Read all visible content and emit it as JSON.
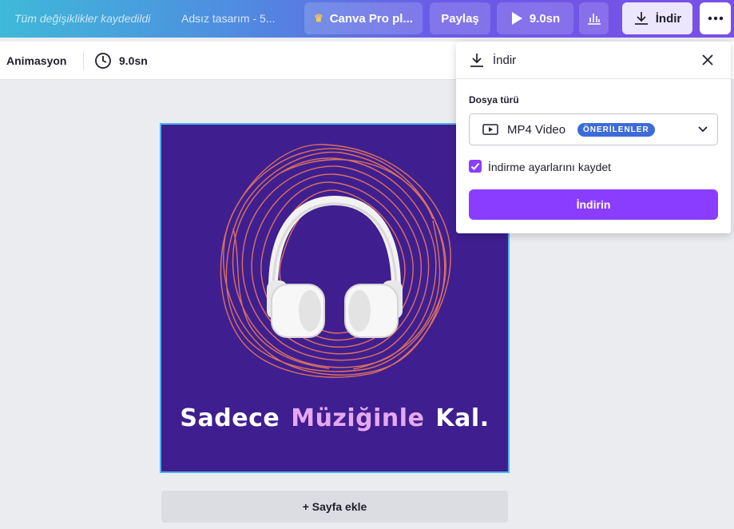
{
  "topbar": {
    "saved_status": "Tüm değişiklikler kaydedildi",
    "design_title": "Adsız tasarım - 5...",
    "pro_label": "Canva Pro pl...",
    "share_label": "Paylaş",
    "play_duration": "9.0sn",
    "download_label": "İndir",
    "icons": [
      "crown-icon",
      "play-icon",
      "stats-icon",
      "download-icon",
      "more-icon"
    ]
  },
  "toolbar": {
    "animation_label": "Animasyon",
    "duration": "9.0sn"
  },
  "canvas": {
    "caption_part1": "Sadece",
    "caption_highlight": "Müziğinle",
    "caption_part2": "Kal.",
    "background_color": "#3f1f8f",
    "highlight_color": "#e6a8f2"
  },
  "add_page_label": "+ Sayfa ekle",
  "download_panel": {
    "title": "İndir",
    "file_type_label": "Dosya türü",
    "file_type_value": "MP4 Video",
    "recommended_badge": "ÖNERİLENLER",
    "save_settings_label": "İndirme ayarlarını kaydet",
    "save_settings_checked": true,
    "download_button_label": "İndirin",
    "accent_color": "#8b3dff"
  }
}
